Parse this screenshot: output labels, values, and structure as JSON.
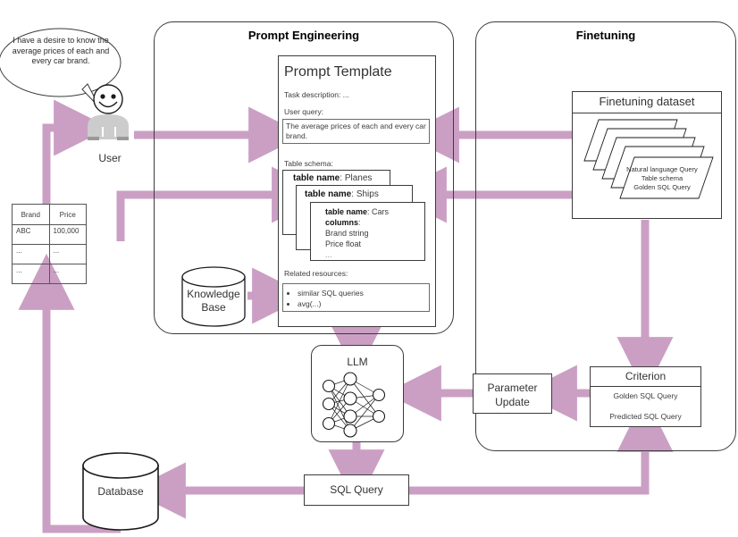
{
  "groups": {
    "prompt_engineering": "Prompt Engineering",
    "finetuning": "Finetuning"
  },
  "speech_bubble": {
    "text": "I have a desire to know the average prices of each and every car brand."
  },
  "user": {
    "label": "User"
  },
  "result_table": {
    "headers": [
      "Brand",
      "Price"
    ],
    "rows": [
      [
        "ABC",
        "100,000"
      ],
      [
        "...",
        "..."
      ],
      [
        "...",
        "..."
      ]
    ]
  },
  "knowledge_base": {
    "label": "Knowledge\nBase",
    "line1": "Knowledge",
    "line2": "Base"
  },
  "prompt_template": {
    "title": "Prompt Template",
    "task_description_label": "Task description: ...",
    "user_query_label": "User query:",
    "user_query_value": "The average prices of each and every car brand.",
    "table_schema_label": "Table schema:",
    "schema_cards": [
      {
        "key": "table name",
        "value": "Planes"
      },
      {
        "key": "table name",
        "value": "Ships"
      },
      {
        "key": "table name",
        "value": "Cars",
        "columns_label": "columns",
        "columns": [
          "Brand string",
          "Price float",
          "..."
        ]
      }
    ],
    "related_resources_label": "Related resources:",
    "related_resources": [
      "similar SQL queries",
      "avg(...)"
    ]
  },
  "finetuning_dataset": {
    "title": "Finetuning dataset",
    "card_lines": [
      "Natural language Query",
      "Table schema",
      "Golden SQL Query"
    ]
  },
  "llm": {
    "label": "LLM"
  },
  "parameter_update": {
    "line1": "Parameter",
    "line2": "Update"
  },
  "criterion": {
    "title": "Criterion",
    "rows": [
      "Golden SQL Query",
      "Predicted SQL Query"
    ]
  },
  "sql_query": {
    "label": "SQL Query"
  },
  "database": {
    "label": "Database"
  },
  "colors": {
    "arrow": "#cb9fc4",
    "stroke": "#3b3b3b",
    "user_body": "#cccccc",
    "user_shoe": "#999999"
  }
}
